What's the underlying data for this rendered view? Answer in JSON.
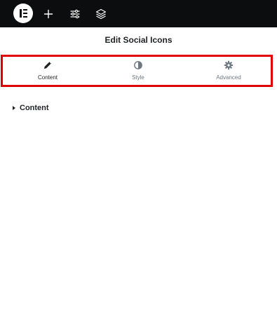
{
  "topbar": {
    "logo": "elementor-logo",
    "icons": [
      "plus-icon",
      "sliders-icon",
      "layers-icon"
    ]
  },
  "panel": {
    "title": "Edit Social Icons"
  },
  "tabs": [
    {
      "label": "Content",
      "icon": "pencil-icon",
      "active": true
    },
    {
      "label": "Style",
      "icon": "half-circle-icon",
      "active": false
    },
    {
      "label": "Advanced",
      "icon": "gear-icon",
      "active": false
    }
  ],
  "sections": [
    {
      "label": "Content",
      "icon": "caret-right-icon",
      "expanded": false
    }
  ],
  "colors": {
    "topbar": "#0c0d0e",
    "highlight_border": "#e10000",
    "text": "#1f2124",
    "muted": "#6d7882"
  }
}
